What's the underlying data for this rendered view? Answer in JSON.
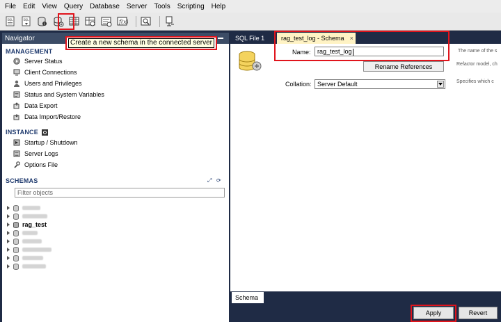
{
  "menu": [
    "File",
    "Edit",
    "View",
    "Query",
    "Database",
    "Server",
    "Tools",
    "Scripting",
    "Help"
  ],
  "toolbar": {
    "icons": [
      "new-sql-tab-icon",
      "open-sql-file-icon",
      "query-inspector-icon",
      "create-schema-icon",
      "create-table-icon",
      "create-view-icon",
      "create-procedure-icon",
      "create-function-icon",
      "search-table-data-icon",
      "reconnect-icon"
    ]
  },
  "navigator": {
    "title": "Navigator",
    "tooltip": "Create a new schema in the connected server",
    "management": {
      "title": "MANAGEMENT",
      "items": [
        "Server Status",
        "Client Connections",
        "Users and Privileges",
        "Status and System Variables",
        "Data Export",
        "Data Import/Restore"
      ]
    },
    "instance": {
      "title": "INSTANCE",
      "items": [
        "Startup / Shutdown",
        "Server Logs",
        "Options File"
      ]
    },
    "schemas": {
      "title": "SCHEMAS",
      "filter_placeholder": "Filter objects",
      "visible_schema": "rag_test"
    }
  },
  "tabs": {
    "sql_file": "SQL File 1",
    "schema_tab": "rag_test_log - Schema",
    "close": "×"
  },
  "schema_editor": {
    "name_label": "Name:",
    "name_value": "rag_test_log",
    "rename_button": "Rename References",
    "collation_label": "Collation:",
    "collation_value": "Server Default",
    "hint_name": "The name of the s",
    "hint_refactor": "Refactor model, ch",
    "hint_collation": "Specifies which c"
  },
  "bottom": {
    "tab": "Schema",
    "apply": "Apply",
    "revert": "Revert"
  },
  "colors": {
    "highlight": "#e0141c",
    "panel_dark": "#1f2b45",
    "active_tab": "#fff3c4"
  }
}
